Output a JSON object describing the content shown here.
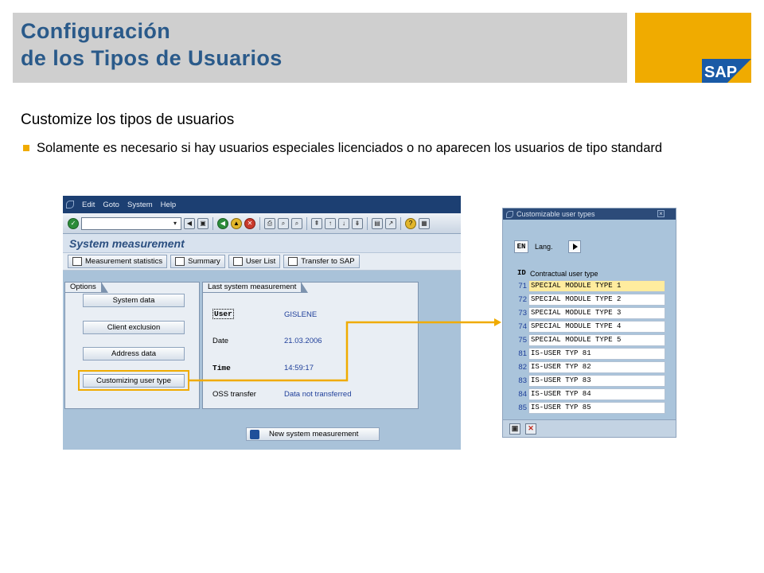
{
  "slide": {
    "title_line1": "Configuración",
    "title_line2": "de los Tipos de Usuarios",
    "subtitle": "Customize los tipos de usuarios",
    "bullet": "Solamente es necesario si hay usuarios especiales licenciados o no aparecen los usuarios de tipo standard",
    "logo_text": "SAP",
    "accent_color": "#f0ab00",
    "title_color": "#2a5a8a"
  },
  "sap_window": {
    "menu": [
      "Edit",
      "Goto",
      "System",
      "Help"
    ],
    "screen_title": "System measurement",
    "app_toolbar": [
      {
        "label": "Measurement statistics",
        "icon": "statistics-icon"
      },
      {
        "label": "Summary",
        "icon": "printer-icon"
      },
      {
        "label": "User List",
        "icon": "list-icon"
      },
      {
        "label": "Transfer to SAP",
        "icon": "transfer-icon"
      }
    ],
    "options": {
      "title": "Options",
      "buttons": [
        "System data",
        "Client exclusion",
        "Address data",
        "Customizing user type"
      ]
    },
    "last_measurement": {
      "title": "Last system measurement",
      "user_label": "User",
      "user_value": "GISLENE",
      "date_label": "Date",
      "date_value": "21.03.2006",
      "time_label": "Time",
      "time_value": "14:59:17",
      "oss_label": "OSS transfer",
      "oss_value": "Data not transferred"
    },
    "new_measurement_button": "New system measurement"
  },
  "popup": {
    "title": "Customizable user types",
    "lang_key": "EN",
    "lang_label": "Lang.",
    "col_id": "ID",
    "col_type": "Contractual user type",
    "rows": [
      {
        "id": "71",
        "name": "SPECIAL MODULE TYPE 1"
      },
      {
        "id": "72",
        "name": "SPECIAL MODULE TYPE 2"
      },
      {
        "id": "73",
        "name": "SPECIAL MODULE TYPE 3"
      },
      {
        "id": "74",
        "name": "SPECIAL MODULE TYPE 4"
      },
      {
        "id": "75",
        "name": "SPECIAL MODULE TYPE 5"
      },
      {
        "id": "81",
        "name": "IS-USER TYP 81"
      },
      {
        "id": "82",
        "name": "IS-USER TYP 82"
      },
      {
        "id": "83",
        "name": "IS-USER TYP 83"
      },
      {
        "id": "84",
        "name": "IS-USER TYP 84"
      },
      {
        "id": "85",
        "name": "IS-USER TYP 85"
      }
    ]
  }
}
